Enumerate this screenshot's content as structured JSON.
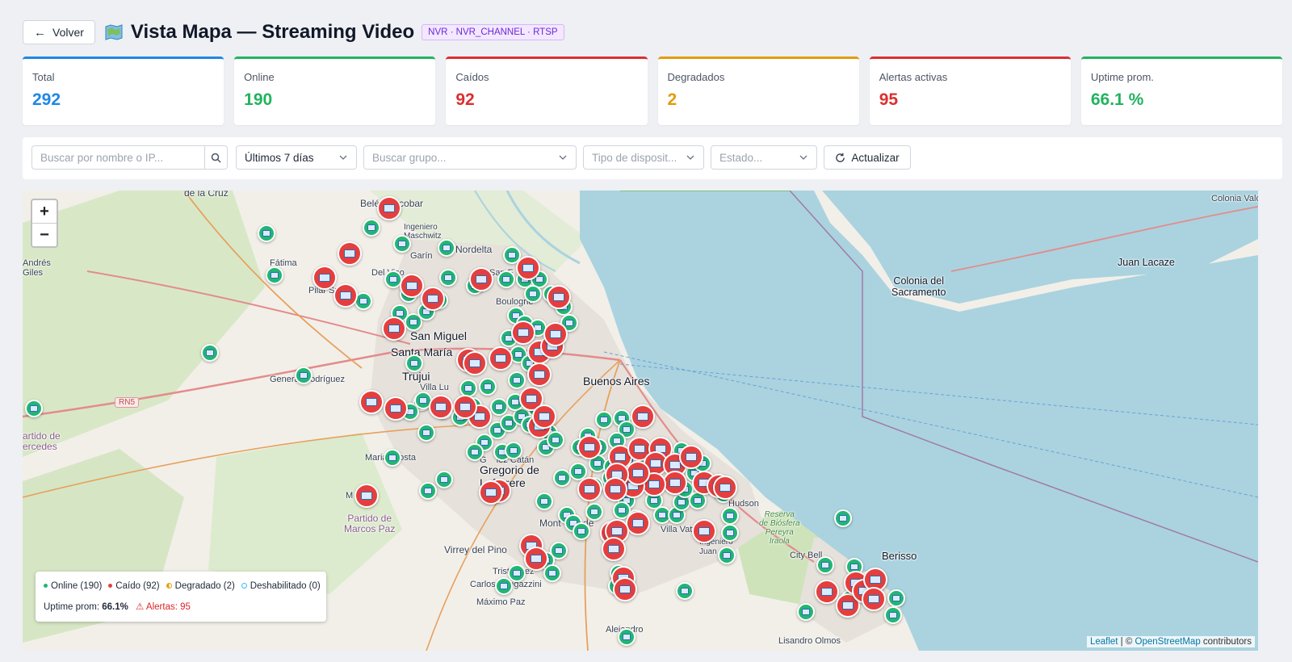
{
  "header": {
    "back_label": "Volver",
    "title": "Vista Mapa — Streaming Video",
    "badge": "NVR · NVR_CHANNEL · RTSP"
  },
  "stats": [
    {
      "label": "Total",
      "value": "292",
      "color": "#1e88e5"
    },
    {
      "label": "Online",
      "value": "190",
      "color": "#22b35e"
    },
    {
      "label": "Caídos",
      "value": "92",
      "color": "#dc2f2f"
    },
    {
      "label": "Degradados",
      "value": "2",
      "color": "#e59b0b"
    },
    {
      "label": "Alertas activas",
      "value": "95",
      "color": "#dc2f2f"
    },
    {
      "label": "Uptime prom.",
      "value": "66.1 %",
      "color": "#22b35e"
    }
  ],
  "filters": {
    "search_placeholder": "Buscar por nombre o IP...",
    "period": "Últimos 7 días",
    "group_placeholder": "Buscar grupo...",
    "device_type_placeholder": "Tipo de disposit...",
    "status_placeholder": "Estado...",
    "refresh_label": "Actualizar"
  },
  "map": {
    "zoom_in": "+",
    "zoom_out": "−",
    "places": {
      "de_la_cruz": "de la Cruz",
      "belen_escobar": "Belén  Escobar",
      "ingeniero_maschwitz": "Ingeniero\nMaschwitz",
      "nordelta": "Nordelta",
      "garin": "Garín",
      "andres_giles": "Andrés\nGiles",
      "fatima": "Fátima",
      "del_viso": "Del Viso",
      "pilar_sur": "Pilar Sur",
      "san_fernando": "San F",
      "boulogne": "Boulogne",
      "san_miguel": "San Miguel",
      "santa_maria": "Santa María",
      "trujui": "Trujui",
      "villa_lu": "Villa Lu",
      "general_rodriguez": "General Rodríguez",
      "buenos_aires": "Buenos Aires",
      "partido_de_mercedes": "artido de\nercedes",
      "mariano_acosta": "Maria   costa",
      "gonzalez_catan": "G    lez Catán",
      "gregorio_de_laferrere": "Gregorio de\nLaferrere",
      "partido_de_marcos_paz": "Partido de\nMarcos Paz",
      "marcos_paz": "M      az",
      "virrey_del_pino": "Virrey del Pino",
      "montegrande": "Mont   rande",
      "tristan_suarez": "Trist   arez",
      "carlos_spegazzini": "Carlos Spegazzini",
      "maximo_paz": "Máximo Paz",
      "alejandro_korn": "Alejandro",
      "villa_vatteone": "Villa Vatt",
      "ingeniero_juan_allan": "Ingeniero\nJuan",
      "hudson": "Hudson",
      "reserva": "Reserva\nde Biósfera\nPereyra\nIraola",
      "city_bell": "City Bell",
      "berisso": "Berisso",
      "lisandro_olmos": "Lisandro Olmos",
      "colonia_del_sacramento": "Colonia del\nSacramento",
      "juan_lacaze": "Juan Lacaze",
      "colonia_valdense": "Colonia Valde",
      "rn5": "RN5"
    },
    "markers": {
      "online": [
        [
          302,
          53
        ],
        [
          312,
          105
        ],
        [
          432,
          46
        ],
        [
          470,
          66
        ],
        [
          525,
          71
        ],
        [
          606,
          80
        ],
        [
          527,
          108
        ],
        [
          516,
          136
        ],
        [
          459,
          110
        ],
        [
          478,
          128
        ],
        [
          422,
          137
        ],
        [
          467,
          152
        ],
        [
          484,
          163
        ],
        [
          500,
          150
        ],
        [
          485,
          214
        ],
        [
          348,
          229
        ],
        [
          232,
          201
        ],
        [
          14,
          270
        ],
        [
          560,
          118
        ],
        [
          599,
          110
        ],
        [
          622,
          110
        ],
        [
          640,
          110
        ],
        [
          632,
          128
        ],
        [
          655,
          128
        ],
        [
          670,
          144
        ],
        [
          677,
          164
        ],
        [
          611,
          155
        ],
        [
          622,
          165
        ],
        [
          638,
          170
        ],
        [
          602,
          183
        ],
        [
          614,
          203
        ],
        [
          645,
          195
        ],
        [
          628,
          214
        ],
        [
          636,
          226
        ],
        [
          612,
          235
        ],
        [
          552,
          245
        ],
        [
          576,
          243
        ],
        [
          494,
          262
        ],
        [
          480,
          274
        ],
        [
          522,
          272
        ],
        [
          542,
          281
        ],
        [
          496,
          260
        ],
        [
          500,
          300
        ],
        [
          558,
          267
        ],
        [
          566,
          280
        ],
        [
          590,
          268
        ],
        [
          628,
          258
        ],
        [
          588,
          297
        ],
        [
          572,
          312
        ],
        [
          594,
          324
        ],
        [
          608,
          322
        ],
        [
          560,
          324
        ],
        [
          602,
          288
        ],
        [
          618,
          280
        ],
        [
          636,
          270
        ],
        [
          610,
          262
        ],
        [
          628,
          290
        ],
        [
          652,
          300
        ],
        [
          648,
          318
        ],
        [
          660,
          309
        ],
        [
          720,
          284
        ],
        [
          742,
          282
        ],
        [
          748,
          296
        ],
        [
          736,
          310
        ],
        [
          714,
          318
        ],
        [
          700,
          304
        ],
        [
          690,
          318
        ],
        [
          712,
          338
        ],
        [
          730,
          342
        ],
        [
          728,
          356
        ],
        [
          740,
          372
        ],
        [
          760,
          336
        ],
        [
          764,
          318
        ],
        [
          748,
          384
        ],
        [
          668,
          356
        ],
        [
          688,
          348
        ],
        [
          708,
          366
        ],
        [
          674,
          402
        ],
        [
          682,
          412
        ],
        [
          692,
          422
        ],
        [
          708,
          398
        ],
        [
          742,
          396
        ],
        [
          760,
          406
        ],
        [
          782,
          384
        ],
        [
          792,
          402
        ],
        [
          810,
          402
        ],
        [
          816,
          386
        ],
        [
          820,
          370
        ],
        [
          836,
          384
        ],
        [
          832,
          350
        ],
        [
          842,
          338
        ],
        [
          816,
          322
        ],
        [
          868,
          376
        ],
        [
          876,
          403
        ],
        [
          876,
          424
        ],
        [
          872,
          452
        ],
        [
          646,
          385
        ],
        [
          522,
          358
        ],
        [
          502,
          372
        ],
        [
          458,
          331
        ],
        [
          664,
          446
        ],
        [
          648,
          458
        ],
        [
          656,
          474
        ],
        [
          612,
          474
        ],
        [
          596,
          490
        ],
        [
          738,
          474
        ],
        [
          736,
          490
        ],
        [
          820,
          496
        ],
        [
          748,
          553
        ],
        [
          970,
          522
        ],
        [
          994,
          464
        ],
        [
          1016,
          406
        ],
        [
          1030,
          466
        ],
        [
          1048,
          482
        ],
        [
          1058,
          484
        ],
        [
          1082,
          505
        ],
        [
          1078,
          526
        ],
        [
          1024,
          506
        ]
      ],
      "down": [
        [
          454,
          22
        ],
        [
          405,
          78
        ],
        [
          374,
          108
        ],
        [
          400,
          130
        ],
        [
          482,
          118
        ],
        [
          508,
          134
        ],
        [
          568,
          110
        ],
        [
          460,
          171
        ],
        [
          552,
          210
        ],
        [
          560,
          214
        ],
        [
          592,
          208
        ],
        [
          640,
          200
        ],
        [
          656,
          193
        ],
        [
          640,
          228
        ],
        [
          630,
          258
        ],
        [
          566,
          280
        ],
        [
          548,
          268
        ],
        [
          518,
          268
        ],
        [
          432,
          262
        ],
        [
          462,
          270
        ],
        [
          590,
          372
        ],
        [
          580,
          374
        ],
        [
          640,
          292
        ],
        [
          646,
          280
        ],
        [
          660,
          178
        ],
        [
          620,
          176
        ],
        [
          626,
          96
        ],
        [
          664,
          132
        ],
        [
          702,
          318
        ],
        [
          740,
          330
        ],
        [
          764,
          320
        ],
        [
          768,
          280
        ],
        [
          790,
          320
        ],
        [
          784,
          338
        ],
        [
          808,
          340
        ],
        [
          828,
          330
        ],
        [
          844,
          362
        ],
        [
          862,
          366
        ],
        [
          870,
          368
        ],
        [
          808,
          362
        ],
        [
          782,
          364
        ],
        [
          756,
          366
        ],
        [
          762,
          350
        ],
        [
          736,
          352
        ],
        [
          734,
          370
        ],
        [
          702,
          370
        ],
        [
          730,
          424
        ],
        [
          762,
          412
        ],
        [
          736,
          422
        ],
        [
          844,
          422
        ],
        [
          732,
          444
        ],
        [
          744,
          480
        ],
        [
          746,
          494
        ],
        [
          630,
          440
        ],
        [
          636,
          456
        ],
        [
          426,
          378
        ],
        [
          996,
          497
        ],
        [
          1022,
          514
        ],
        [
          1032,
          486
        ],
        [
          1042,
          496
        ],
        [
          1056,
          482
        ],
        [
          1054,
          506
        ]
      ]
    },
    "attribution_link1": "Leaflet",
    "attribution_sep": " | © ",
    "attribution_link2": "OpenStreetMap",
    "attribution_tail": " contributors"
  },
  "legend": {
    "online": "Online (190)",
    "down": "Caído (92)",
    "degraded": "Degradado (2)",
    "disabled": "Deshabilitado (0)",
    "uptime_label": "Uptime prom:",
    "uptime_value": "66.1%",
    "alerts": "Alertas: 95",
    "colors": {
      "online": "#22b573",
      "down": "#e53e3e",
      "degraded": "#e5a00b",
      "disabled": "#38bdf8"
    }
  }
}
